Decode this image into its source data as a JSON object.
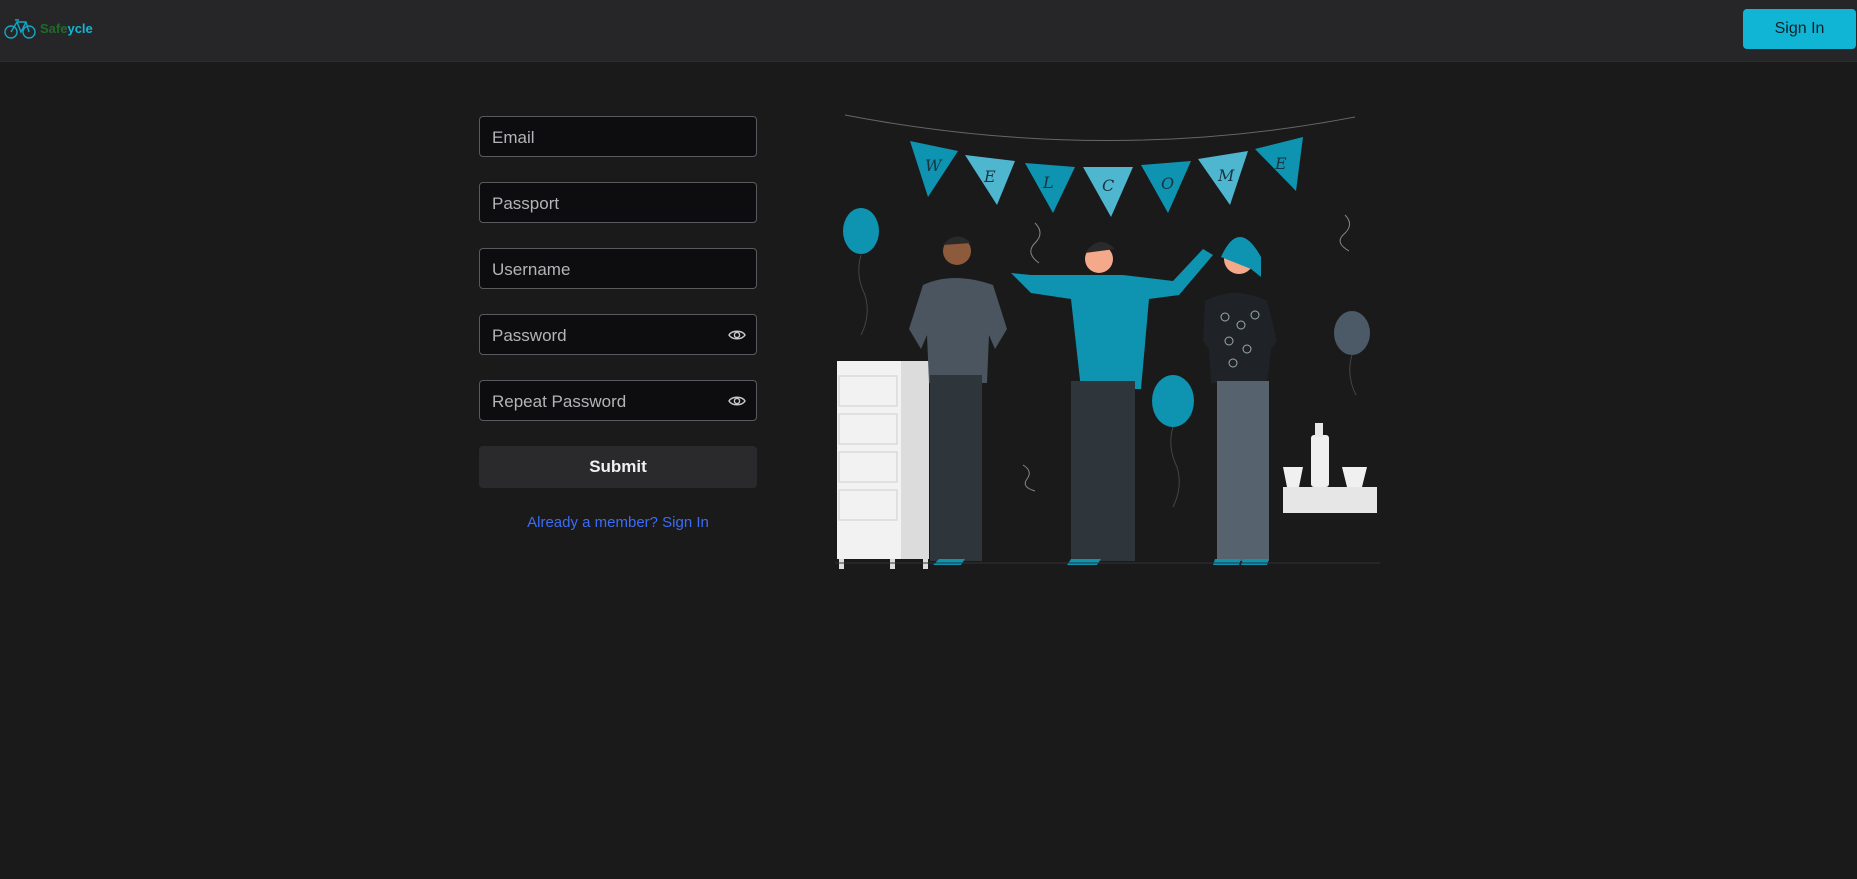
{
  "header": {
    "logo_text_a": "Safe",
    "logo_text_b": "ycle",
    "signin_label": "Sign In",
    "logo_icon": "bicycle-icon"
  },
  "form": {
    "email_placeholder": "Email",
    "passport_placeholder": "Passport",
    "username_placeholder": "Username",
    "password_placeholder": "Password",
    "repeat_password_placeholder": "Repeat Password",
    "submit_label": "Submit",
    "member_link": "Already a member? Sign In",
    "visibility_icon": "eye-icon"
  },
  "illustration": {
    "banner_letters": [
      "W",
      "E",
      "L",
      "C",
      "O",
      "M",
      "E"
    ]
  },
  "colors": {
    "accent": "#10b5d6",
    "link": "#3b6cf6",
    "background": "#1a1a1b",
    "header": "#262628"
  }
}
